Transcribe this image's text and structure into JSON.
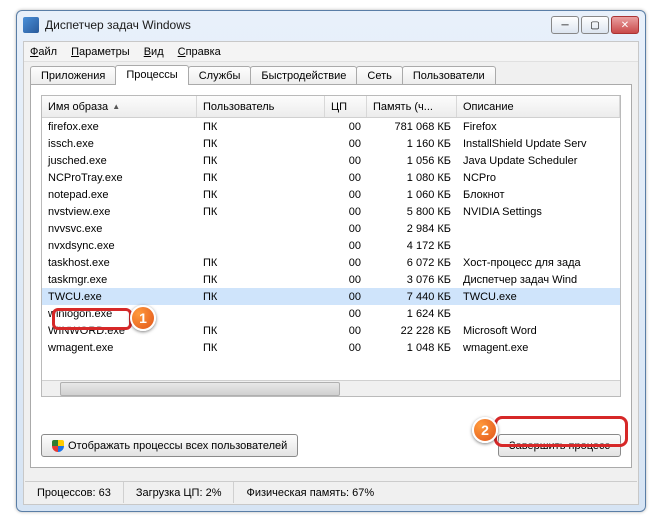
{
  "window": {
    "title": "Диспетчер задач Windows"
  },
  "menu": {
    "file": "Файл",
    "options": "Параметры",
    "view": "Вид",
    "help": "Справка"
  },
  "tabs": {
    "apps": "Приложения",
    "processes": "Процессы",
    "services": "Службы",
    "performance": "Быстродействие",
    "network": "Сеть",
    "users": "Пользователи"
  },
  "columns": {
    "image": "Имя образа",
    "user": "Пользователь",
    "cpu": "ЦП",
    "mem": "Память (ч...",
    "desc": "Описание"
  },
  "rows": [
    {
      "image": "firefox.exe",
      "user": "ПК",
      "cpu": "00",
      "mem": "781 068 КБ",
      "desc": "Firefox"
    },
    {
      "image": "issch.exe",
      "user": "ПК",
      "cpu": "00",
      "mem": "1 160 КБ",
      "desc": "InstallShield Update Serv"
    },
    {
      "image": "jusched.exe",
      "user": "ПК",
      "cpu": "00",
      "mem": "1 056 КБ",
      "desc": "Java Update Scheduler"
    },
    {
      "image": "NCProTray.exe",
      "user": "ПК",
      "cpu": "00",
      "mem": "1 080 КБ",
      "desc": "NCPro"
    },
    {
      "image": "notepad.exe",
      "user": "ПК",
      "cpu": "00",
      "mem": "1 060 КБ",
      "desc": "Блокнот"
    },
    {
      "image": "nvstview.exe",
      "user": "ПК",
      "cpu": "00",
      "mem": "5 800 КБ",
      "desc": "NVIDIA Settings"
    },
    {
      "image": "nvvsvc.exe",
      "user": "",
      "cpu": "00",
      "mem": "2 984 КБ",
      "desc": ""
    },
    {
      "image": "nvxdsync.exe",
      "user": "",
      "cpu": "00",
      "mem": "4 172 КБ",
      "desc": ""
    },
    {
      "image": "taskhost.exe",
      "user": "ПК",
      "cpu": "00",
      "mem": "6 072 КБ",
      "desc": "Хост-процесс для зада"
    },
    {
      "image": "taskmgr.exe",
      "user": "ПК",
      "cpu": "00",
      "mem": "3 076 КБ",
      "desc": "Диспетчер задач Wind"
    },
    {
      "image": "TWCU.exe",
      "user": "ПК",
      "cpu": "00",
      "mem": "7 440 КБ",
      "desc": "TWCU.exe",
      "selected": true
    },
    {
      "image": "winlogon.exe",
      "user": "",
      "cpu": "00",
      "mem": "1 624 КБ",
      "desc": ""
    },
    {
      "image": "WINWORD.exe",
      "user": "ПК",
      "cpu": "00",
      "mem": "22 228 КБ",
      "desc": "Microsoft Word"
    },
    {
      "image": "wmagent.exe",
      "user": "ПК",
      "cpu": "00",
      "mem": "1 048 КБ",
      "desc": "wmagent.exe"
    }
  ],
  "buttons": {
    "show_all": "Отображать процессы всех пользователей",
    "end_process": "Завершить процесс"
  },
  "status": {
    "processes": "Процессов: 63",
    "cpu": "Загрузка ЦП: 2%",
    "mem": "Физическая память: 67%"
  },
  "annotations": {
    "one": "1",
    "two": "2"
  }
}
